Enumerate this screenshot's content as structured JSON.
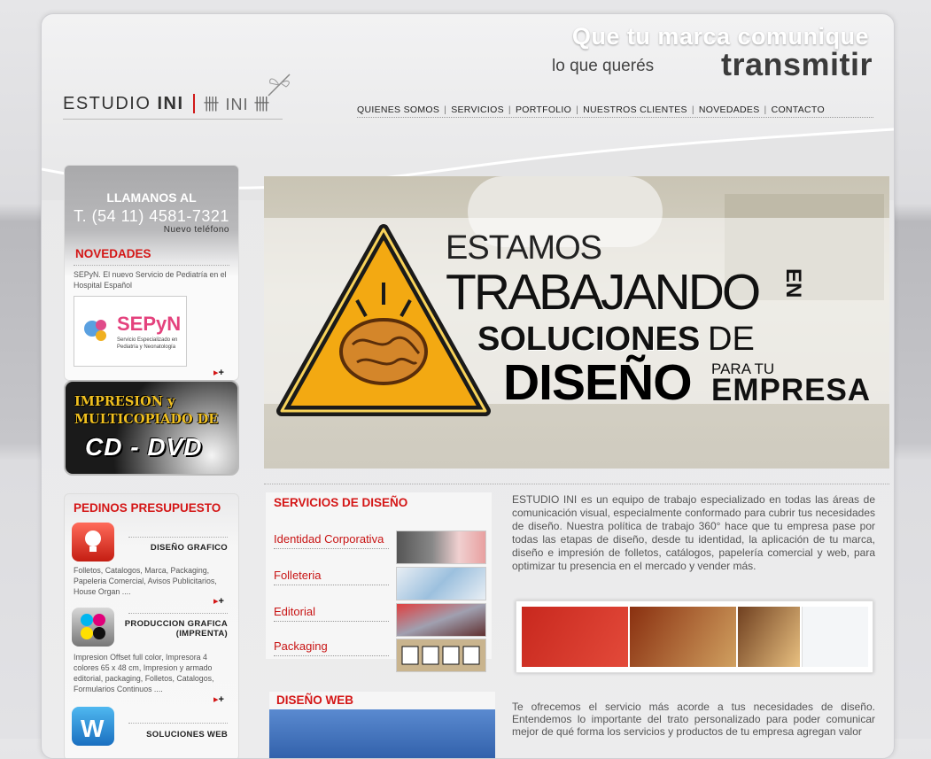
{
  "header": {
    "slogan_line1": "Que tu marca comunique",
    "slogan_line2": "lo que querés",
    "slogan_line3": "transmitir",
    "logo_name": "ESTUDIO",
    "logo_bold": "INI",
    "logo_marks": "卌 INI 卌"
  },
  "nav": [
    "QUIENES SOMOS",
    "SERVICIOS",
    "PORTFOLIO",
    "NUESTROS CLIENTES",
    "NOVEDADES",
    "CONTACTO"
  ],
  "contact": {
    "title": "LLAMANOS AL",
    "phone": "T. (54 11) 4581-7321",
    "note": "Nuevo teléfono"
  },
  "novedades": {
    "title": "NOVEDADES",
    "text": "SEPyN. El nuevo Servicio de Pediatría en el Hospital Español",
    "logo_text": "SEPyN",
    "logo_sub1": "Servicio Especializado en",
    "logo_sub2": "Pediatría y Neonatología"
  },
  "cd_promo": {
    "line1": "IMPRESION y",
    "line2": "MULTICOPIADO DE",
    "line3": "CD - DVD"
  },
  "presupuesto": {
    "title": "PEDINOS PRESUPUESTO",
    "items": [
      {
        "name": "DISEÑO GRAFICO",
        "desc": "Folletos, Catalogos, Marca, Packaging, Papeleria Comercial, Avisos Publicitarios, House Organ ...."
      },
      {
        "name_l1": "PRODUCCION GRAFICA",
        "name_l2": "(IMPRENTA)",
        "desc": "Impresion Offset full color, Impresora 4 colores 65 x 48 cm, Impresion y armado editorial, packaging, Folletos, Catalogos, Formularios Continuos ...."
      },
      {
        "name": "SOLUCIONES WEB"
      }
    ]
  },
  "banner": {
    "w1": "ESTAMOS",
    "w2": "TRABAJANDO",
    "w3": "EN",
    "w4": "SOLUCIONES",
    "w5": "DE",
    "w6": "DISEÑO",
    "w7": "PARA TU",
    "w8": "EMPRESA"
  },
  "services": {
    "title": "SERVICIOS DE DISEÑO",
    "items": [
      "Identidad Corporativa",
      "Folleteria",
      "Editorial",
      "Packaging"
    ]
  },
  "about": "ESTUDIO INI es un equipo de trabajo especializado en todas las áreas de comunicación visual, especialmente conformado para cubrir tus necesidades de diseño. Nuestra política de trabajo 360° hace que tu empresa pase por todas las etapas de diseño, desde tu identidad, la aplicación de tu marca, diseño e impresión de folletos, catálogos, papelería comercial y web, para optimizar tu presencia en el mercado y vender más.",
  "web": {
    "title": "DISEÑO WEB",
    "text": "Te ofrecemos el servicio más acorde a tus necesidades de diseño. Entendemos lo importante del trato personalizado para poder comunicar mejor de qué forma los servicios y productos de tu empresa agregan valor"
  },
  "more_label": "+",
  "colors": {
    "accent": "#d41616",
    "text": "#555555"
  }
}
